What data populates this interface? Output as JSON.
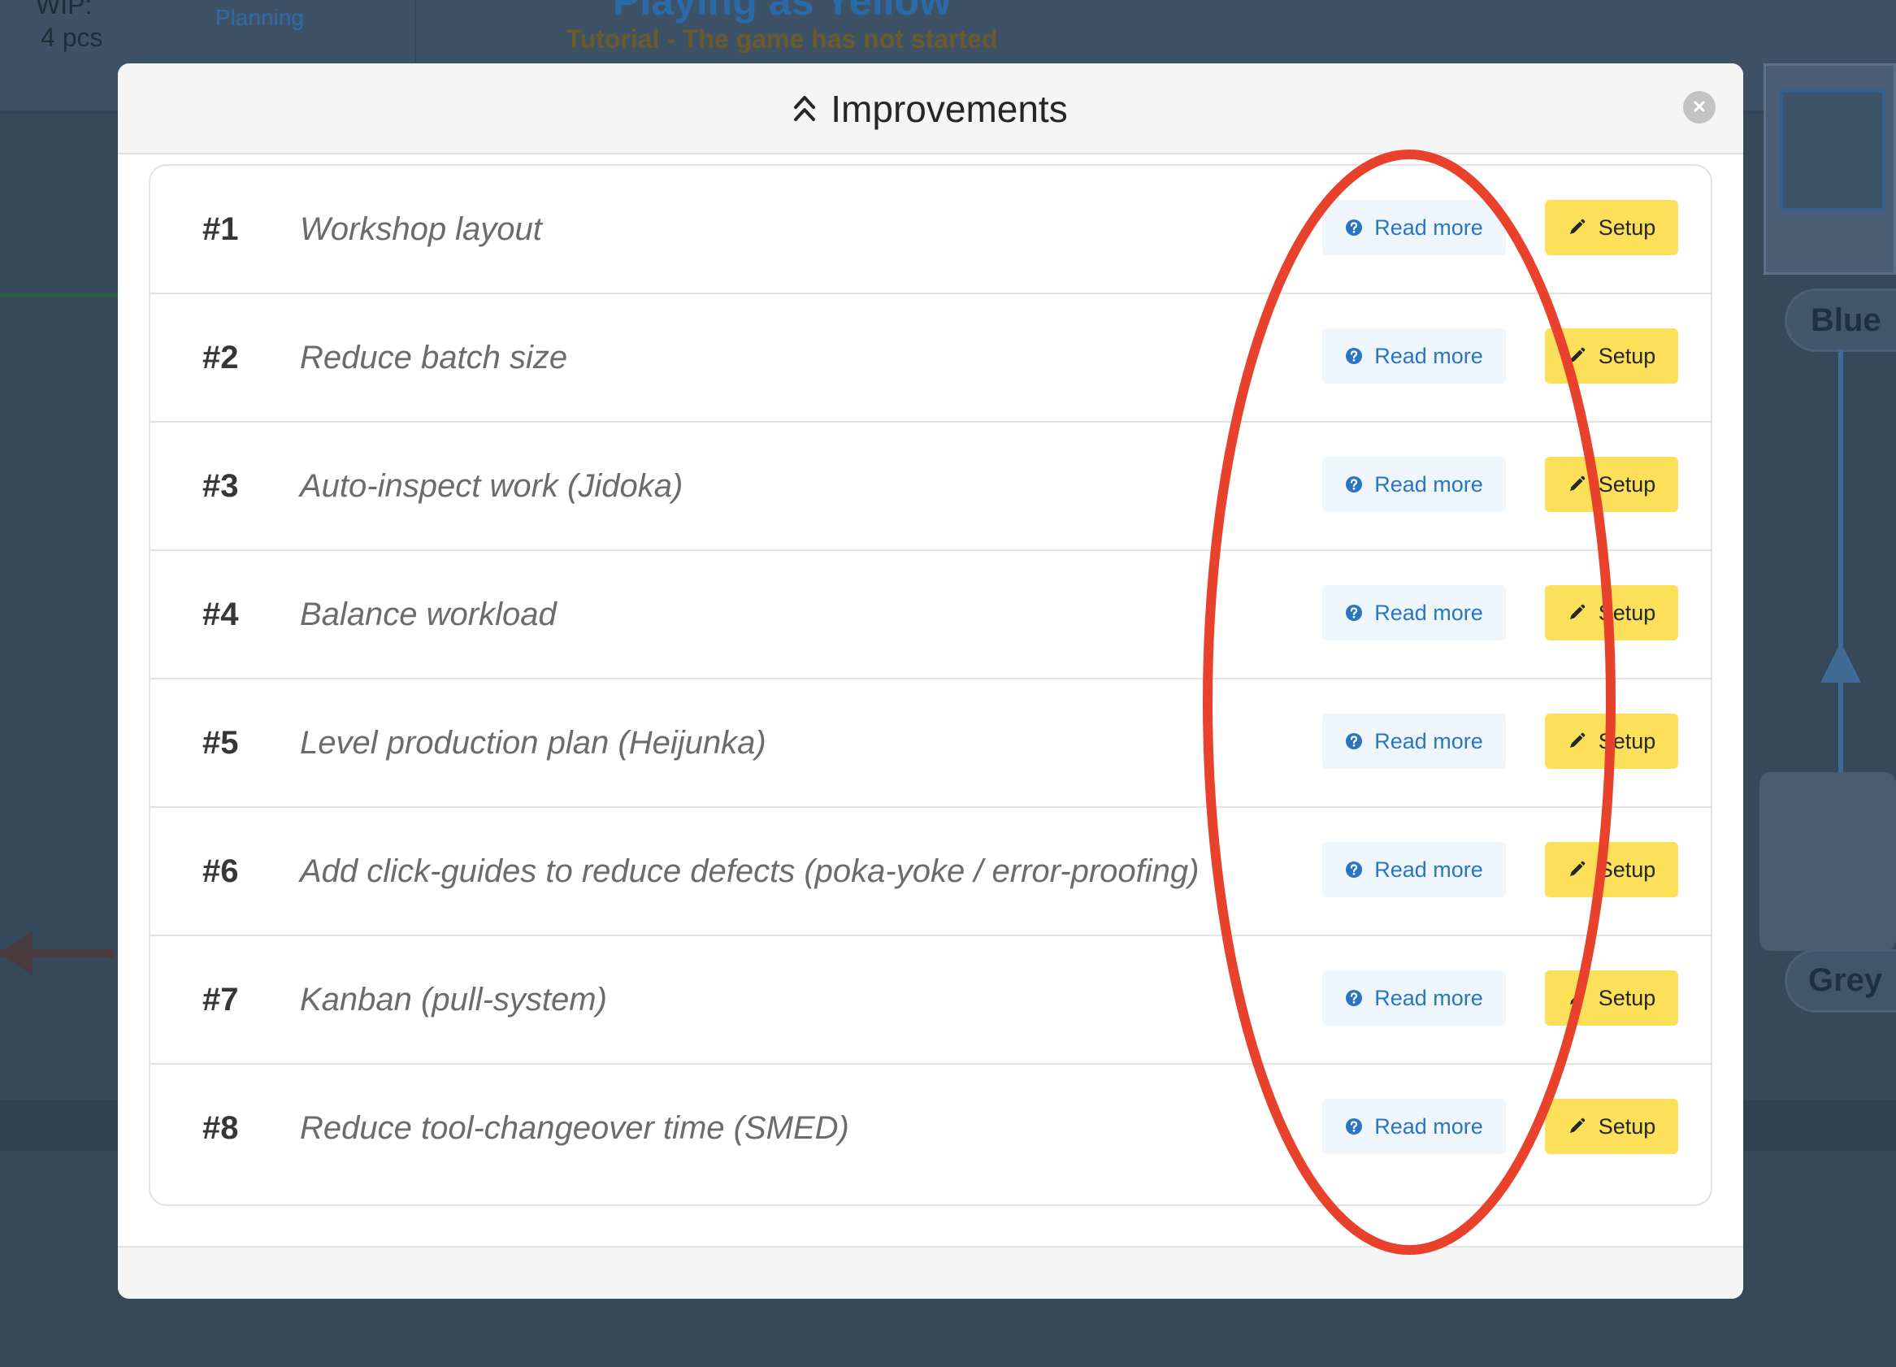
{
  "background": {
    "wip_label": "WIP:",
    "wip_value": "4 pcs",
    "planning_label": "Planning",
    "title": "Playing as Yellow",
    "subtitle": "Tutorial - The game has not started",
    "stations": [
      "Blue",
      "Grey"
    ]
  },
  "modal": {
    "title": "Improvements",
    "title_icon": "chevron-double-up-icon",
    "close_icon": "close-icon"
  },
  "improvements": [
    {
      "num": "#1",
      "name": "Workshop layout"
    },
    {
      "num": "#2",
      "name": "Reduce batch size"
    },
    {
      "num": "#3",
      "name": "Auto-inspect work (Jidoka)"
    },
    {
      "num": "#4",
      "name": "Balance workload"
    },
    {
      "num": "#5",
      "name": "Level production plan (Heijunka)"
    },
    {
      "num": "#6",
      "name": "Add click-guides to reduce defects (poka-yoke / error-proofing)"
    },
    {
      "num": "#7",
      "name": "Kanban (pull-system)"
    },
    {
      "num": "#8",
      "name": "Reduce tool-changeover time (SMED)"
    }
  ],
  "buttons": {
    "read_more": "Read more",
    "setup": "Setup",
    "read_more_icon": "help-circle-icon",
    "setup_icon": "pencil-icon"
  },
  "colors": {
    "read_more_bg": "#eef6fc",
    "read_more_text": "#2a75c2",
    "setup_bg": "#fde05a",
    "annotation": "#e8412c"
  }
}
